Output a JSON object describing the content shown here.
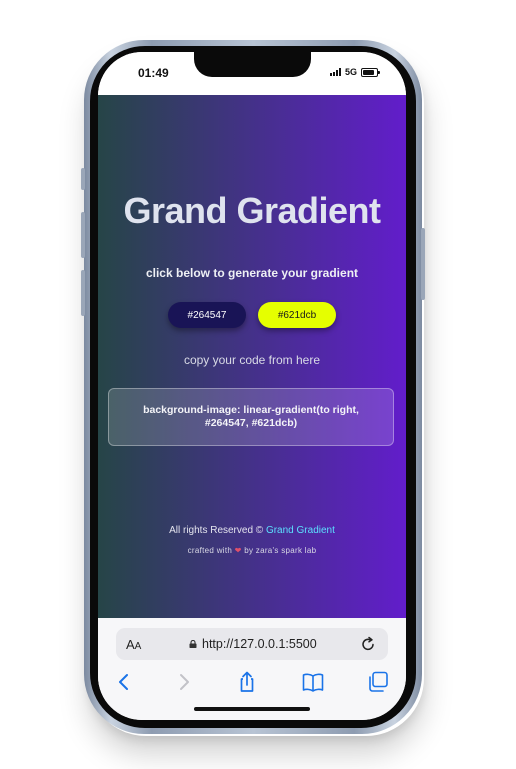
{
  "status_bar": {
    "time": "01:49",
    "network": "5G"
  },
  "page": {
    "title": "Grand Gradient",
    "subtitle": "click below to generate your gradient",
    "color1": "#264547",
    "color2": "#621dcb",
    "copy_label": "copy your code from here",
    "code": "background-image: linear-gradient(to right, #264547, #621dcb)",
    "footer_prefix": "All rights Reserved ©",
    "footer_link": "Grand Gradient",
    "crafted_prefix": "crafted with",
    "crafted_suffix": "by zara's spark lab"
  },
  "browser": {
    "aa_label_big": "A",
    "aa_label_small": "A",
    "url": "http://127.0.0.1:5500"
  },
  "colors": {
    "gradient_start": "#264547",
    "gradient_end": "#621dcb",
    "button1_bg": "#191456",
    "button2_bg": "#e5ff00",
    "footer_link": "#5ce0ff"
  },
  "icons": [
    "lock-icon",
    "reload-icon",
    "back-icon",
    "forward-icon",
    "share-icon",
    "bookmarks-icon",
    "tabs-icon",
    "signal-icon",
    "battery-icon",
    "heart-icon"
  ]
}
